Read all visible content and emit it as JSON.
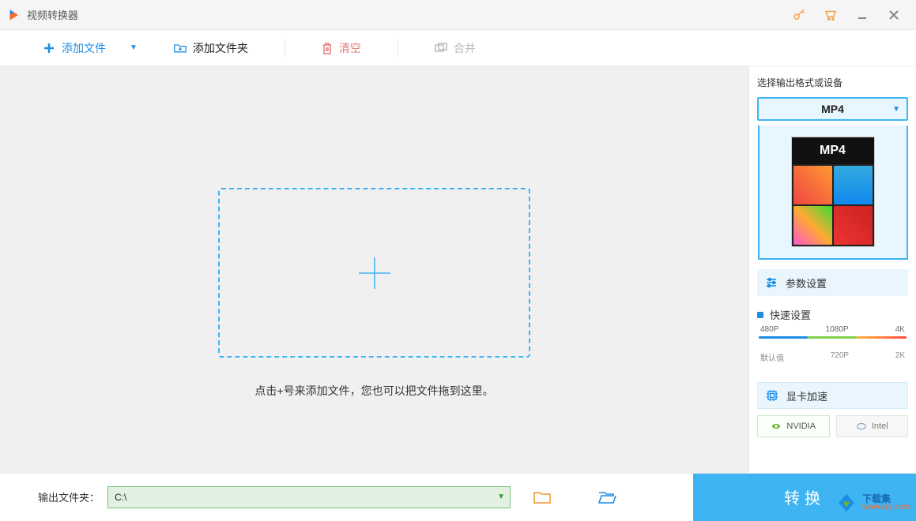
{
  "window": {
    "title": "视频转换器"
  },
  "toolbar": {
    "add_file": "添加文件",
    "add_folder": "添加文件夹",
    "clear": "清空",
    "merge": "合并"
  },
  "drop": {
    "hint": "点击+号来添加文件，您也可以把文件拖到这里。"
  },
  "right": {
    "choose_label": "选择输出格式或设备",
    "format": "MP4",
    "thumb_label": "MP4",
    "param_settings": "参数设置",
    "quick_settings": "快速设置",
    "scale_top": [
      "480P",
      "1080P",
      "4K"
    ],
    "scale_bottom": [
      "默认值",
      "720P",
      "2K"
    ],
    "gpu_accel": "显卡加速",
    "chips": {
      "nvidia": "NVIDIA",
      "intel": "Intel"
    }
  },
  "bottom": {
    "output_label": "输出文件夹：",
    "output_path": "C:\\",
    "convert": "转换"
  },
  "watermark": {
    "name": "下载集",
    "url": "www.xzji.com"
  }
}
